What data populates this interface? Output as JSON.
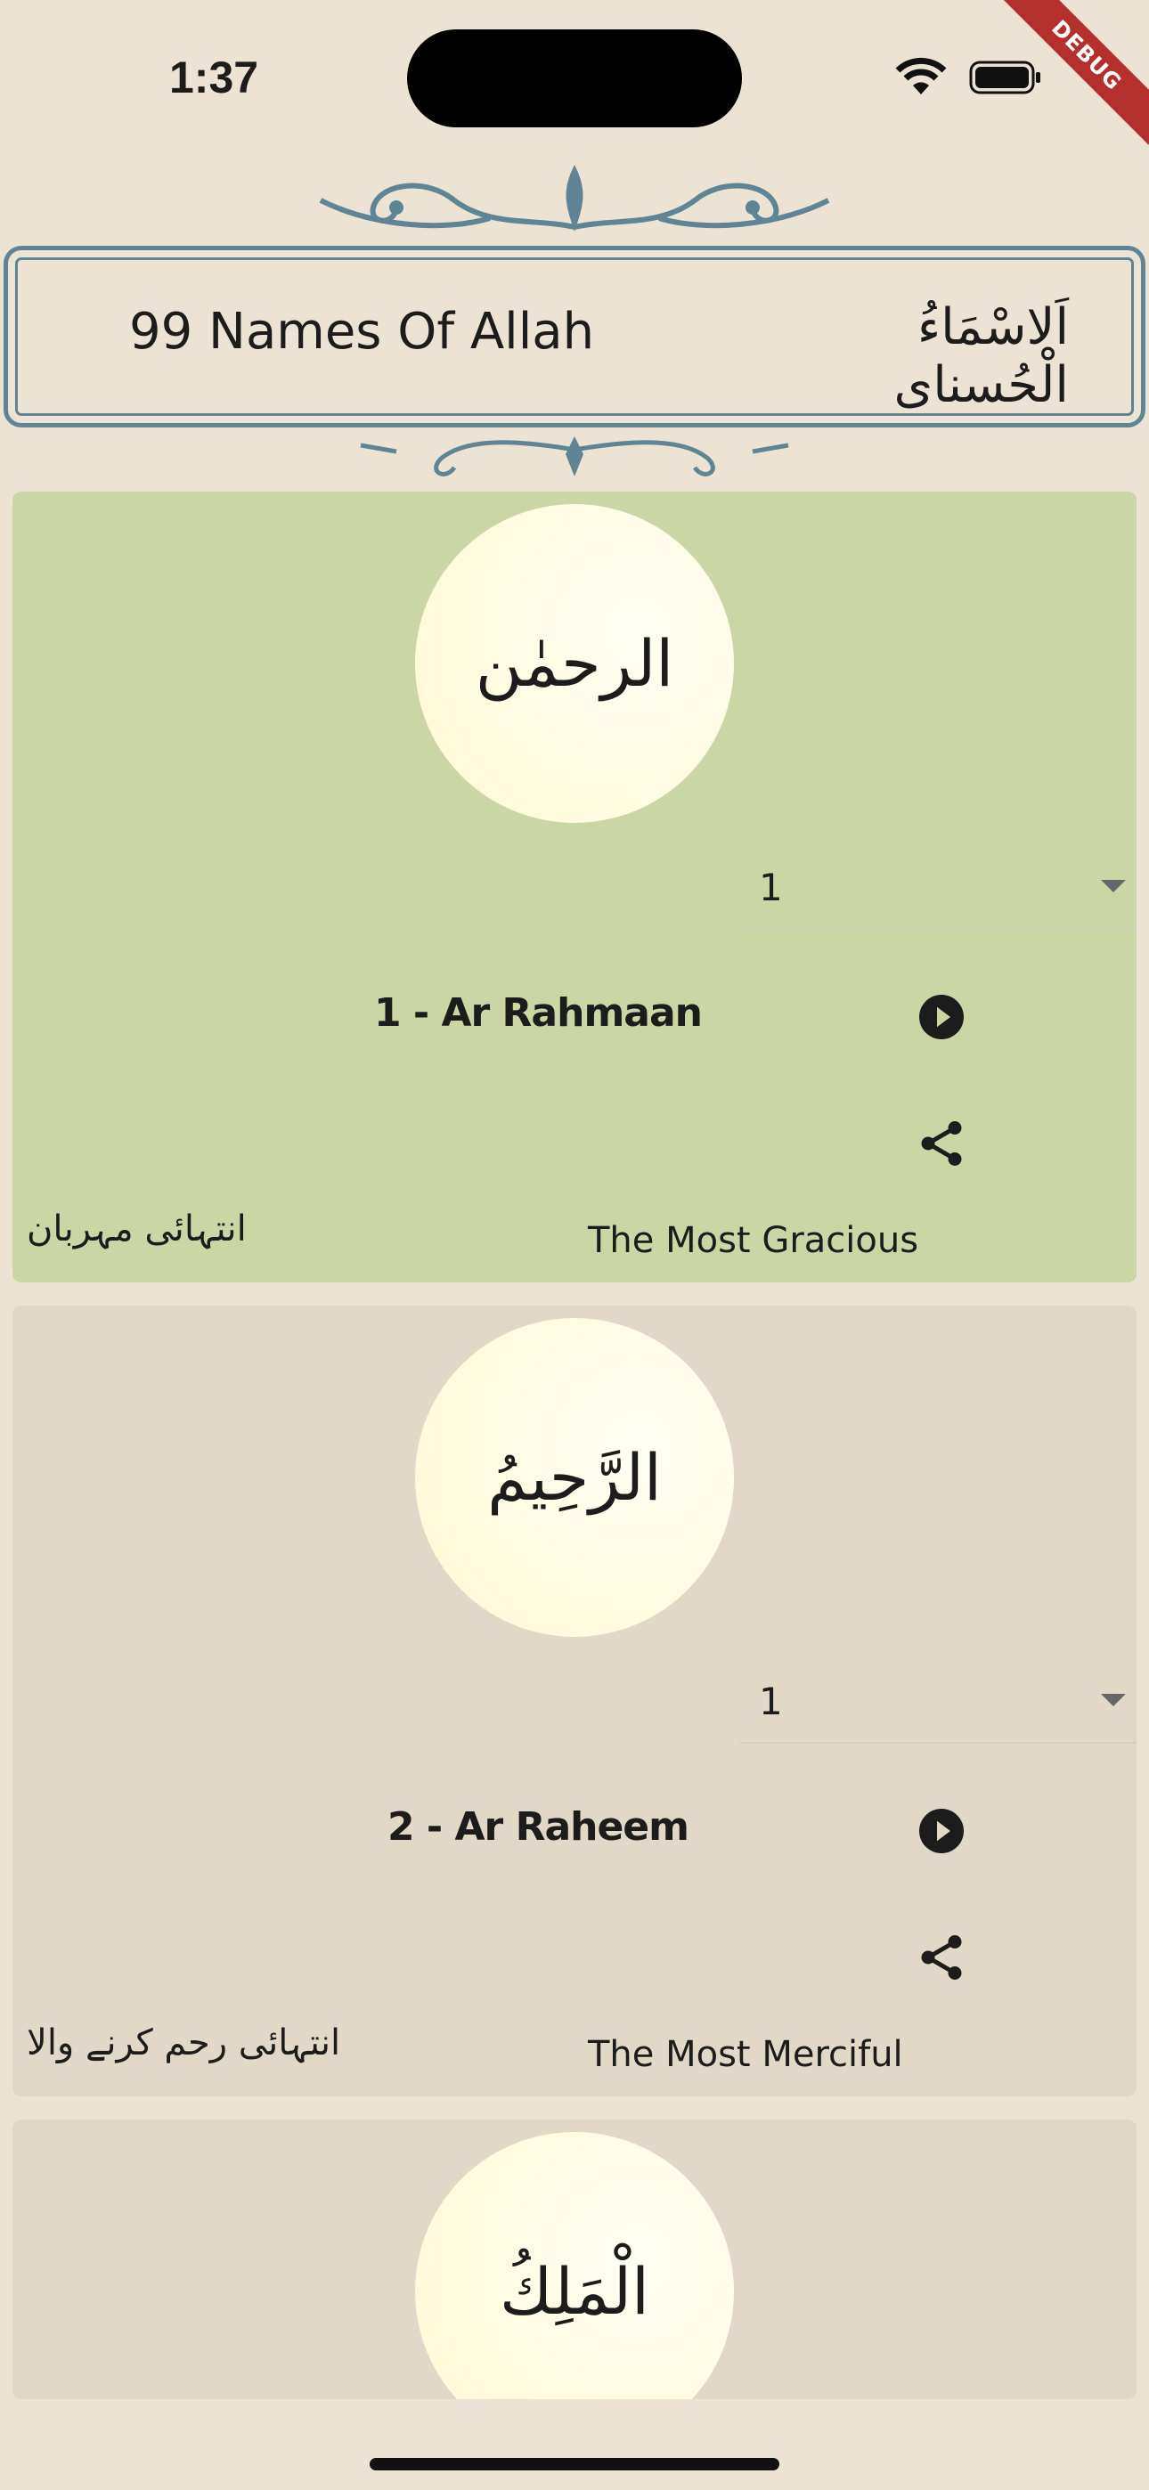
{
  "status_bar": {
    "time": "1:37",
    "debug_label": "DEBUG"
  },
  "header": {
    "title": "99 Names Of Allah",
    "arabic_title": "اَلاسْمَاءُ الْحُسناى"
  },
  "colors": {
    "highlight_card": "#cad7a5",
    "card": "#e2d8c7",
    "frame": "#5f8595"
  },
  "cards": [
    {
      "arabic": "الرحمٰن",
      "dropdown_value": "1",
      "name": "1  - Ar Rahmaan",
      "urdu": "انتہائی مہربان",
      "english": "The Most Gracious",
      "icons": [
        "play-circle-icon",
        "share-icon"
      ]
    },
    {
      "arabic": "الرَّحِيمُ",
      "dropdown_value": "1",
      "name": "2  - Ar Raheem",
      "urdu": "انتہائی رحم کرنے والا",
      "english": "The Most Merciful",
      "icons": [
        "play-circle-icon",
        "share-icon"
      ]
    },
    {
      "arabic": "الْمَلِكُ"
    }
  ]
}
